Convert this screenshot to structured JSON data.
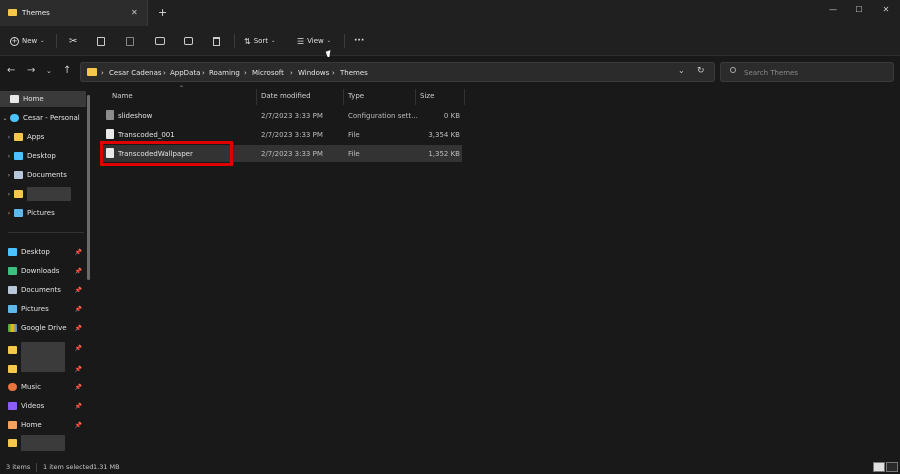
{
  "window": {
    "tab_title": "Themes",
    "close_tab_glyph": "✕",
    "new_tab_glyph": "+",
    "minimize_glyph": "—",
    "maximize_glyph": "☐",
    "close_glyph": "✕"
  },
  "toolbar": {
    "new_label": "New",
    "sort_label": "Sort",
    "view_label": "View",
    "more_label": "···"
  },
  "address": {
    "crumbs": [
      "Cesar Cadenas",
      "AppData",
      "Roaming",
      "Microsoft",
      "Windows",
      "Themes"
    ],
    "search_placeholder": "Search Themes"
  },
  "sidebar": {
    "home": "Home",
    "cesar": "Cesar - Personal",
    "tree": [
      "Apps",
      "Desktop",
      "Documents",
      "",
      "Pictures"
    ],
    "quick": [
      "Desktop",
      "Downloads",
      "Documents",
      "Pictures",
      "Google Drive",
      "",
      "",
      "Music",
      "Videos",
      "Home",
      ""
    ]
  },
  "columns": {
    "name": "Name",
    "date": "Date modified",
    "type": "Type",
    "size": "Size"
  },
  "files": [
    {
      "name": "slideshow",
      "date": "2/7/2023 3:33 PM",
      "type": "Configuration sett...",
      "size": "0 KB"
    },
    {
      "name": "Transcoded_001",
      "date": "2/7/2023 3:33 PM",
      "type": "File",
      "size": "3,354 KB"
    },
    {
      "name": "TranscodedWallpaper",
      "date": "2/7/2023 3:33 PM",
      "type": "File",
      "size": "1,352 KB"
    }
  ],
  "status": {
    "items": "3 items",
    "selected": "1 item selected",
    "size": "1.31 MB"
  },
  "colors": {
    "folder": "#f5c84c",
    "highlight": "#e00000",
    "accent": "#4cc2ff"
  }
}
